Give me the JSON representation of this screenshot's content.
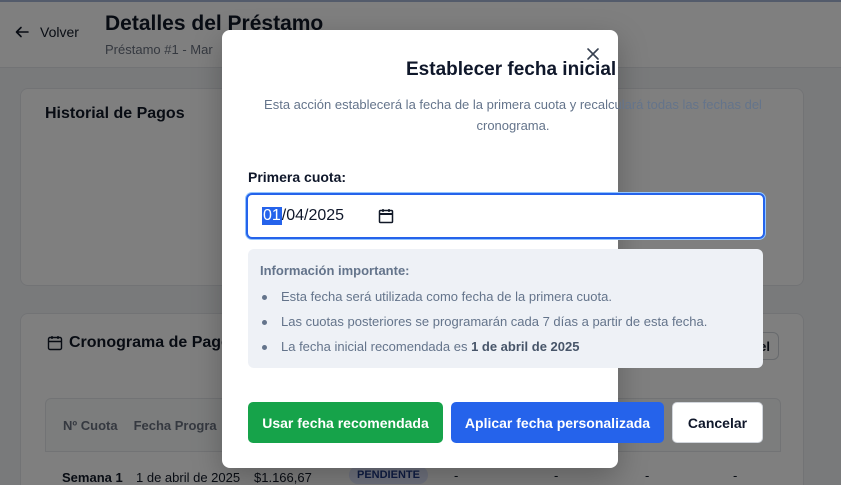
{
  "header": {
    "back_label": "Volver",
    "title": "Detalles del Préstamo",
    "subtitle": "Préstamo #1 - Mar"
  },
  "history": {
    "title": "Historial de Pagos"
  },
  "schedule": {
    "title": "Cronograma de Pagos",
    "side_button_label": "el",
    "columns": [
      "Nº Cuota",
      "Fecha Progra"
    ],
    "rows": [
      {
        "cuota": "Semana 1",
        "fecha": "1 de abril de 2025",
        "monto": "$1.166,67",
        "estado": "PENDIENTE",
        "dashes": [
          "-",
          "-",
          "-",
          "-"
        ]
      }
    ]
  },
  "modal": {
    "title": "Establecer fecha inicial",
    "description": "Esta acción establecerá la fecha de la primera cuota y recalculará todas las fechas del cronograma.",
    "field_label": "Primera cuota:",
    "date_value": {
      "day": "01",
      "rest": "/04/2025"
    },
    "info": {
      "title": "Información importante:",
      "items": [
        "Esta fecha será utilizada como fecha de la primera cuota.",
        "Las cuotas posteriores se programarán cada 7 días a partir de esta fecha."
      ],
      "recommended_prefix": "La fecha inicial recomendada es ",
      "recommended_date": "1 de abril de 2025"
    },
    "buttons": {
      "recommended": "Usar fecha recomendada",
      "apply": "Aplicar fecha personalizada",
      "cancel": "Cancelar"
    }
  },
  "colors": {
    "green": "#16a34a",
    "blue": "#2563eb",
    "badge_bg": "#e0e7ff"
  }
}
